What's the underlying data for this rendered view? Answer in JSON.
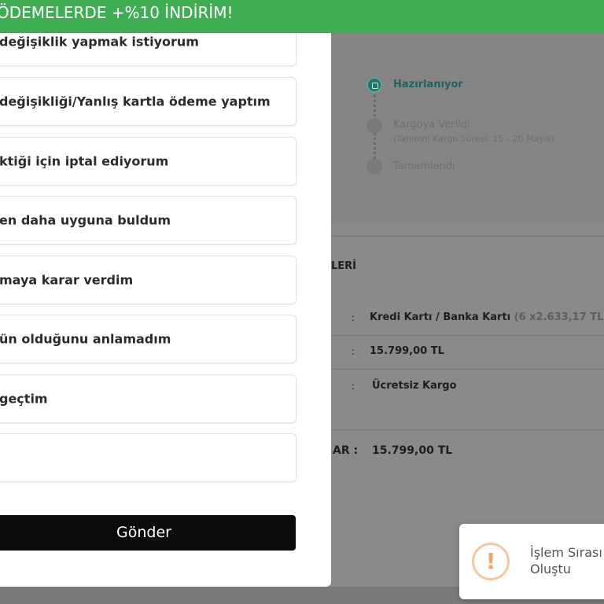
{
  "banner": {
    "text": "ÖDEMELERDE +%10 İNDİRİM!"
  },
  "modal": {
    "options": [
      "değişiklik yapmak istiyorum",
      "değişikliği/Yanlış kartla ödeme yaptım",
      "ktiği için iptal ediyorum",
      "en daha uyguna buldum",
      "maya karar verdim",
      "ün olduğunu anlamadım",
      "geçtim",
      ""
    ],
    "send_label": "Gönder"
  },
  "timeline": {
    "steps": [
      {
        "label": "Hazırlanıyor",
        "state": "active"
      },
      {
        "label": "Kargoya Verildi",
        "sub": "(Tahmini Kargo Süresi: 15 - 20 Mayıs)",
        "state": "pending"
      },
      {
        "label": "Tamamlandı",
        "state": "pending"
      }
    ]
  },
  "summary": {
    "section_title": "LERİ",
    "colon": ":",
    "payment_method": "Kredi Kartı / Banka Kartı",
    "installment": "(6 x2.633,17 TL)",
    "amount": "15.799,00 TL",
    "shipping": "Ücretsiz Kargo",
    "total_label": "AR :",
    "total_value": "15.799,00 TL"
  },
  "toast": {
    "icon": "exclamation-icon",
    "line1": "İşlem Sırası",
    "line2": "Oluştu"
  },
  "colors": {
    "banner": "#3fae52",
    "accent": "#20635e",
    "button": "#0b0b0b",
    "warning": "#f3a466"
  }
}
